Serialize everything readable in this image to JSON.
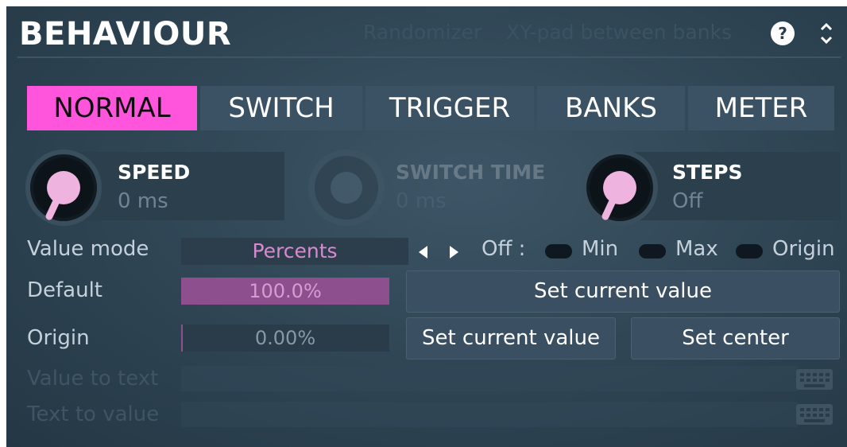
{
  "header": {
    "title": "BEHAVIOUR",
    "randomizer_label": "Randomizer",
    "xy_pad_label": "XY-pad between banks",
    "help_label": "?"
  },
  "tabs": [
    {
      "label": "NORMAL",
      "active": true
    },
    {
      "label": "SWITCH",
      "active": false
    },
    {
      "label": "TRIGGER",
      "active": false
    },
    {
      "label": "BANKS",
      "active": false
    },
    {
      "label": "METER",
      "active": false
    }
  ],
  "knobs": {
    "speed": {
      "title": "SPEED",
      "value": "0 ms",
      "enabled": true
    },
    "switch_time": {
      "title": "SWITCH TIME",
      "value": "0 ms",
      "enabled": false
    },
    "steps": {
      "title": "STEPS",
      "value": "Off",
      "enabled": true
    }
  },
  "value_mode": {
    "label": "Value mode",
    "value": "Percents",
    "off_label": "Off :",
    "min_label": "Min",
    "max_label": "Max",
    "origin_label": "Origin"
  },
  "default": {
    "label": "Default",
    "value": "100.0%",
    "fraction": 1.0,
    "button_label": "Set current value"
  },
  "origin": {
    "label": "Origin",
    "value": "0.00%",
    "fraction": 0.0,
    "set_current_label": "Set current value",
    "set_center_label": "Set center"
  },
  "value_to_text": {
    "label": "Value to text"
  },
  "text_to_value": {
    "label": "Text to value"
  },
  "colors": {
    "accent": "#ff55dd",
    "panel_bg": "#2e4453",
    "tab_bg": "#3a5264",
    "fill": "#8e4f8e"
  }
}
